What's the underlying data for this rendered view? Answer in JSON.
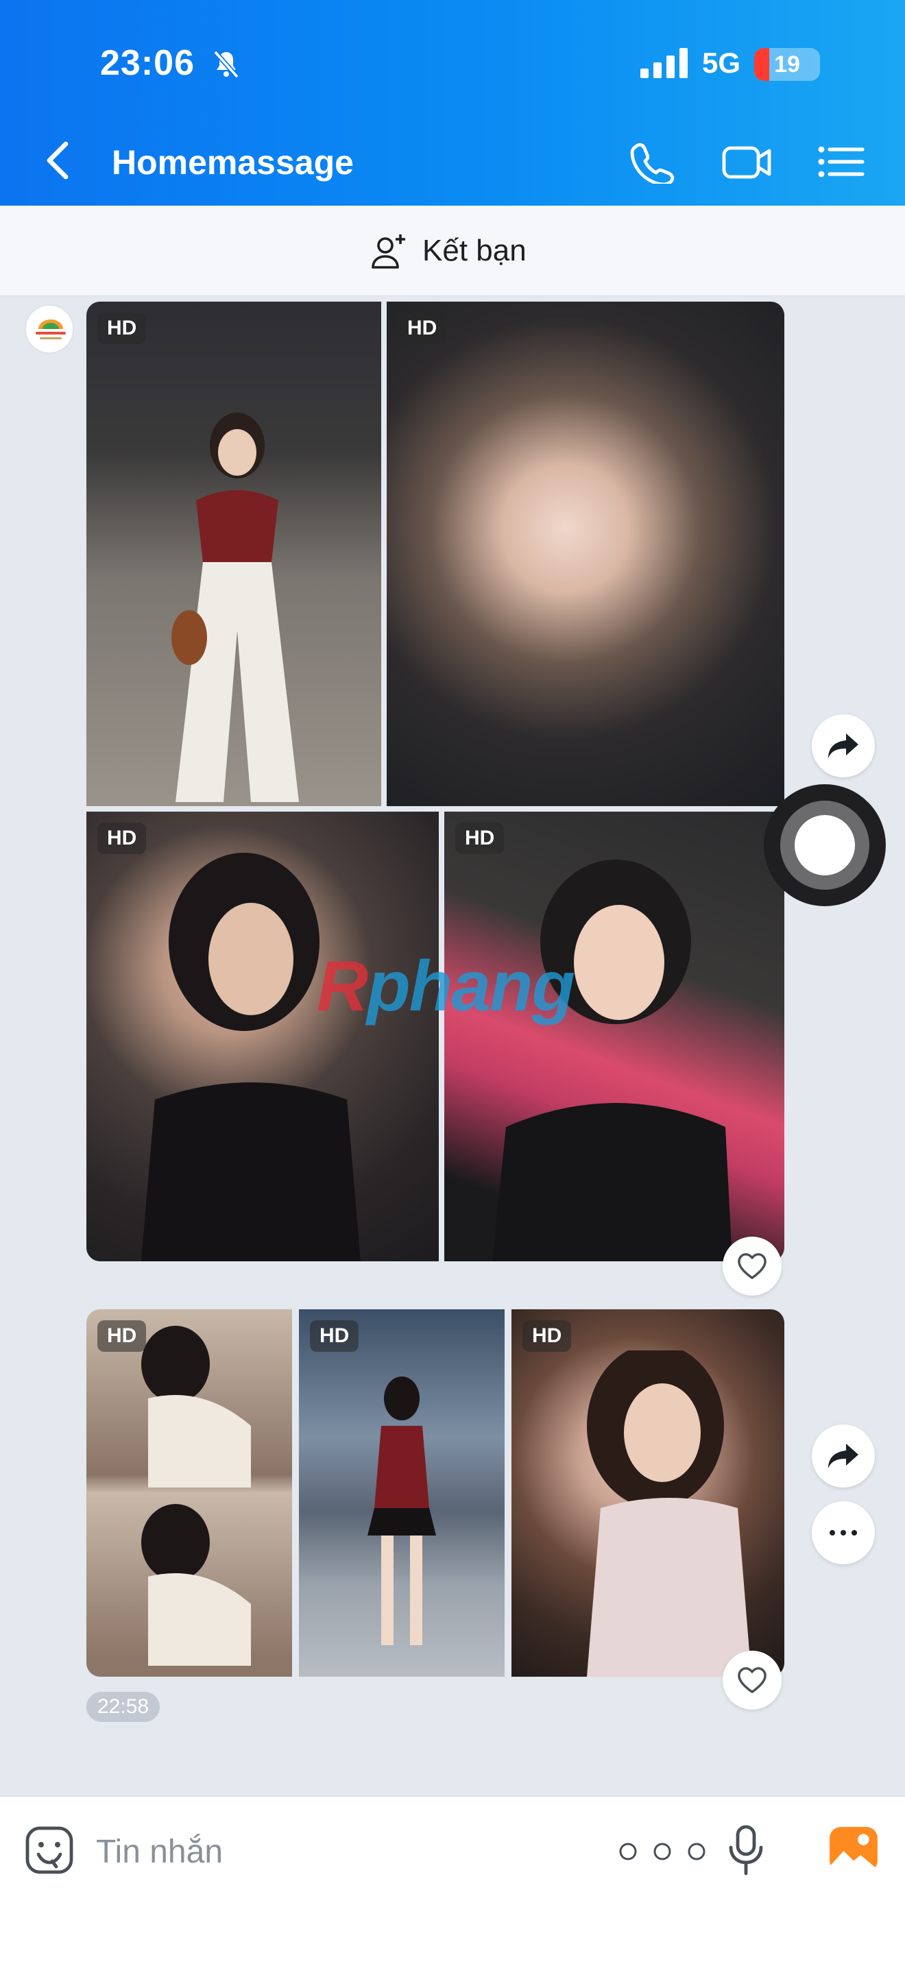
{
  "status_bar": {
    "time": "23:06",
    "network": "5G",
    "battery": "19",
    "battery_color": "#ff3b30",
    "mute_icon": "bell-slash-icon",
    "signal_icon": "cellular-signal-icon"
  },
  "header": {
    "title": "Homemassage",
    "back_icon": "chevron-left-icon",
    "actions": [
      "phone-icon",
      "video-camera-icon",
      "list-menu-icon"
    ],
    "accent": "#0b74f0"
  },
  "friend_bar": {
    "label": "Kết bạn",
    "icon": "add-user-icon"
  },
  "messages": [
    {
      "photos": [
        {
          "badge": "HD"
        },
        {
          "badge": "HD"
        },
        {
          "badge": "HD"
        },
        {
          "badge": "HD"
        }
      ]
    },
    {
      "photos": [
        {
          "badge": "HD"
        },
        {
          "badge": "HD"
        },
        {
          "badge": "HD"
        }
      ],
      "time": "22:58"
    }
  ],
  "watermark": {
    "first": "R",
    "rest": "phang"
  },
  "composer": {
    "placeholder": "Tin nhắn",
    "icons": [
      "sticker-icon",
      "more-dots-icon",
      "voice-mic-icon",
      "gallery-icon"
    ]
  }
}
